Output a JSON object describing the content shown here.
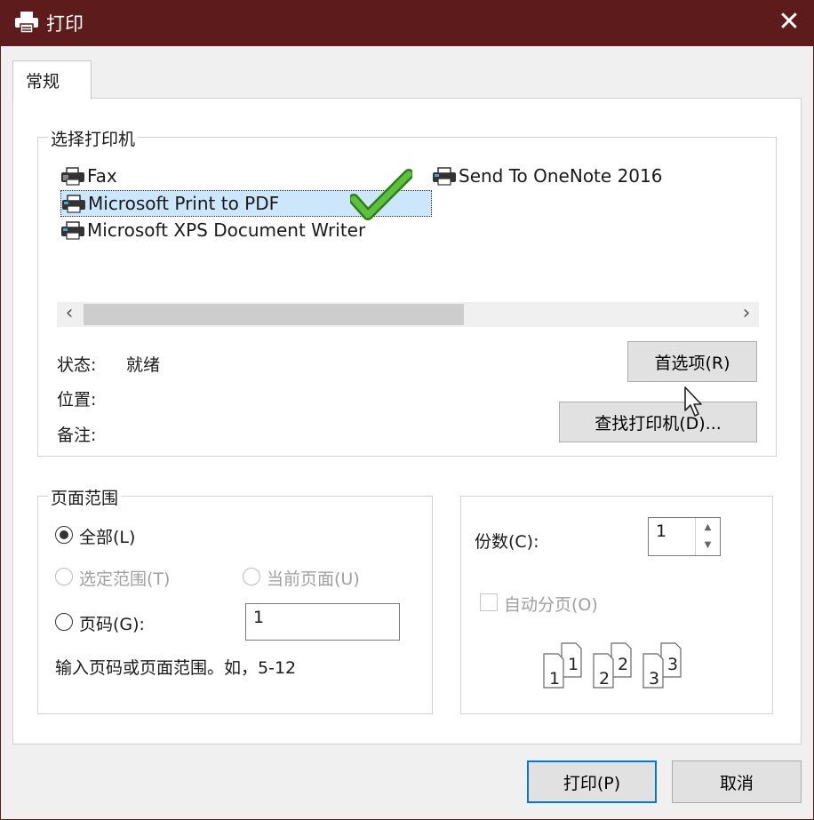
{
  "window": {
    "title": "打印",
    "close_icon": "close-icon"
  },
  "tabs": [
    {
      "label": "常规"
    }
  ],
  "select_printer": {
    "group_title": "选择打印机",
    "printers": [
      {
        "name": "Fax",
        "icon": "fax-icon"
      },
      {
        "name": "Microsoft Print to PDF",
        "icon": "printer-icon",
        "selected": true
      },
      {
        "name": "Microsoft XPS Document Writer",
        "icon": "printer-icon"
      },
      {
        "name": "Send To OneNote 2016",
        "icon": "printer-icon"
      }
    ],
    "status_label": "状态:",
    "status_value": "就绪",
    "location_label": "位置:",
    "comment_label": "备注:",
    "preferences_button": "首选项(R)",
    "find_printer_button": "查找打印机(D)..."
  },
  "page_range": {
    "group_title": "页面范围",
    "all_label": "全部(L)",
    "selection_label": "选定范围(T)",
    "current_page_label": "当前页面(U)",
    "pages_label": "页码(G):",
    "pages_value": "1",
    "hint": "输入页码或页面范围。如，5-12"
  },
  "copies": {
    "label": "份数(C):",
    "value": "1",
    "collate_label": "自动分页(O)",
    "collate_icons": [
      "1",
      "1",
      "2",
      "2",
      "3",
      "3"
    ]
  },
  "footer": {
    "print_button": "打印(P)",
    "cancel_button": "取消"
  },
  "colors": {
    "titlebar": "#5e1b1b",
    "selection": "#cce6fb",
    "accent": "#0078d7",
    "check": "#4caf2c"
  }
}
